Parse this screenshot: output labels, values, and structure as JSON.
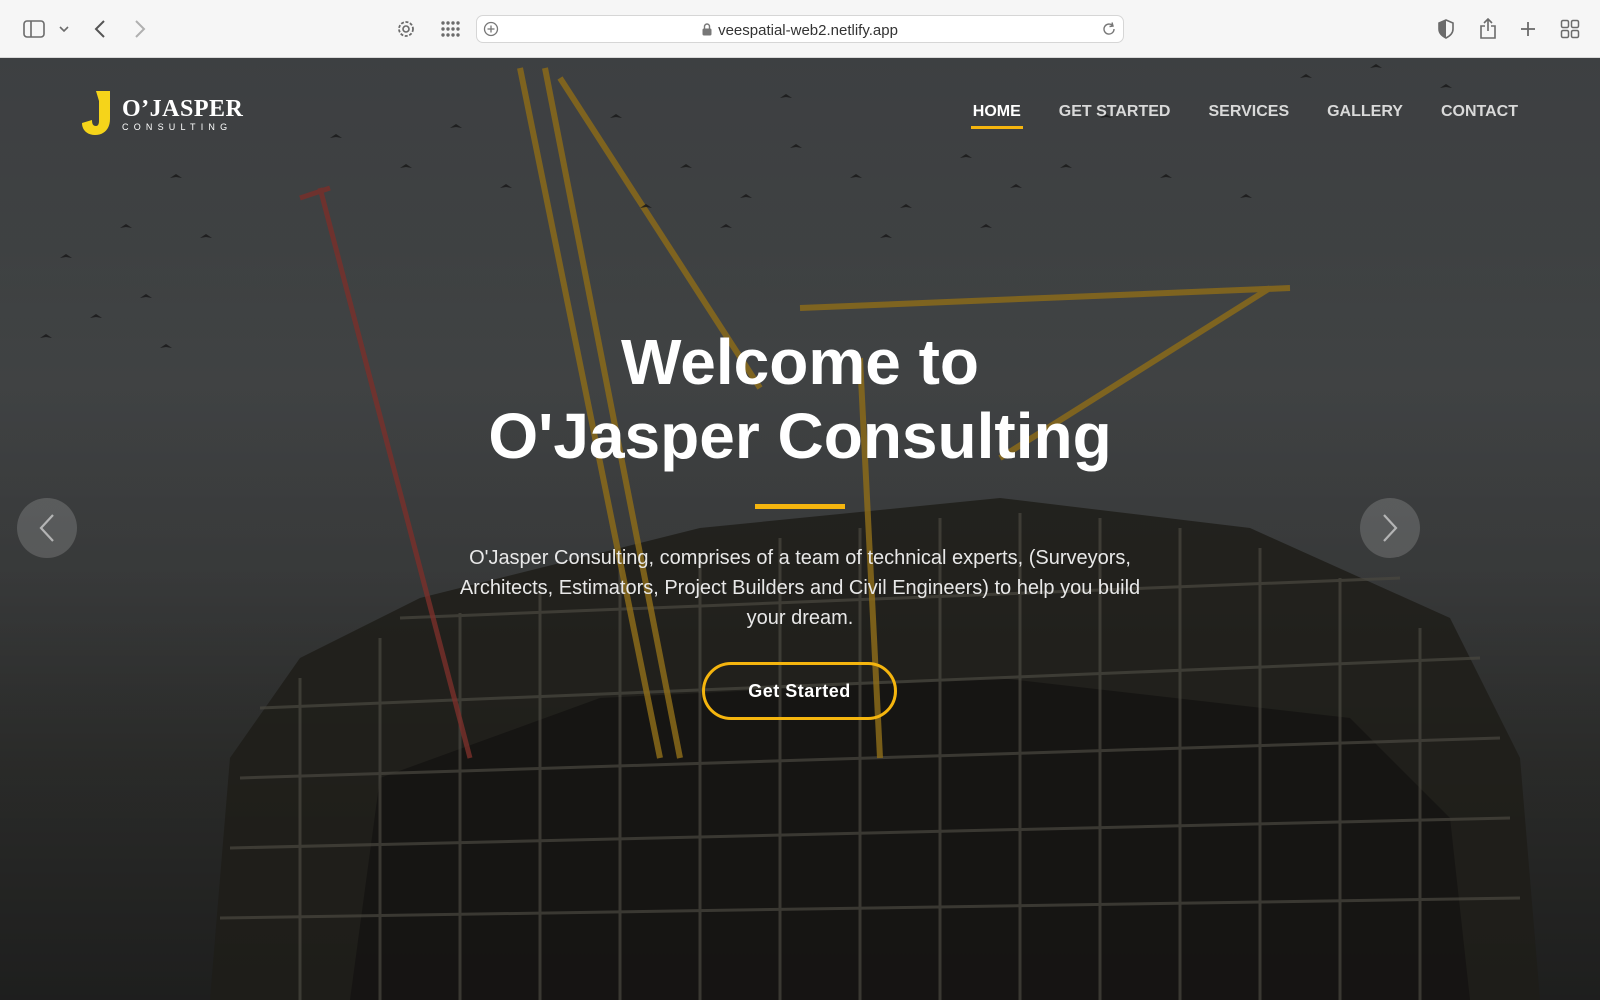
{
  "browser": {
    "url": "veespatial-web2.netlify.app",
    "icons": [
      "sidebar-icon",
      "chevron-down-icon",
      "back-icon",
      "forward-icon",
      "settings-icon",
      "grid-icon",
      "add-icon",
      "lock-icon",
      "reload-icon",
      "privacy-icon",
      "share-icon",
      "new-tab-icon",
      "tab-overview-icon"
    ]
  },
  "site": {
    "logo": {
      "name": "O’JASPER",
      "subtitle": "CONSULTING"
    },
    "nav": [
      {
        "label": "HOME",
        "active": true
      },
      {
        "label": "GET STARTED",
        "active": false
      },
      {
        "label": "SERVICES",
        "active": false
      },
      {
        "label": "GALLERY",
        "active": false
      },
      {
        "label": "CONTACT",
        "active": false
      }
    ],
    "hero": {
      "title_line1": "Welcome to",
      "title_line2": "O'Jasper Consulting",
      "description": "O'Jasper Consulting, comprises of a team of technical experts, (Surveyors, Architects, Estimators, Project Builders and Civil Engineers) to help you build your dream.",
      "cta_label": "Get Started"
    },
    "colors": {
      "accent": "#f5b50e"
    }
  }
}
